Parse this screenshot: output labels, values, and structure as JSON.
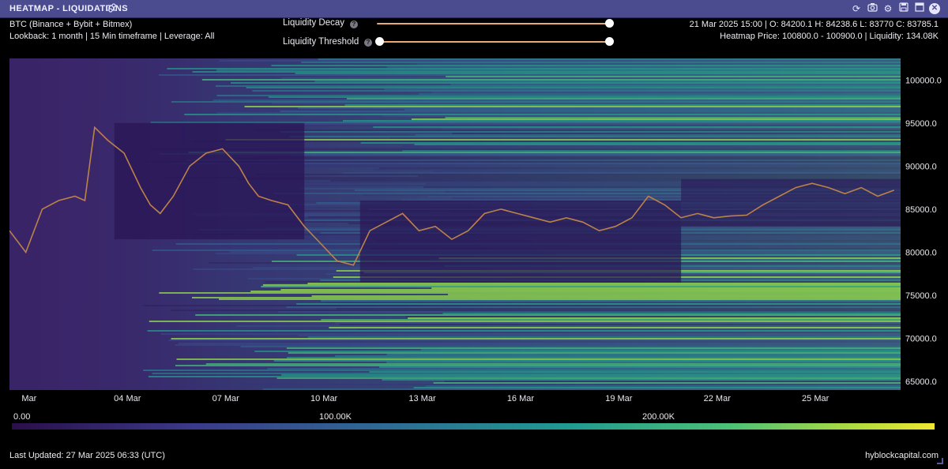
{
  "window": {
    "title": "HEATMAP - LIQUIDATIONS",
    "icons": [
      "sliders-icon",
      "refresh-icon",
      "camera-icon",
      "settings-icon",
      "save-icon",
      "expand-icon",
      "close-icon"
    ]
  },
  "info": {
    "instrument": "BTC (Binance + Bybit + Bitmex)",
    "params": "Lookback: 1 month | 15 Min timeframe | Leverage: All",
    "ohlc": "21 Mar 2025 15:00 | O: 84200.1 H: 84238.6 L: 83770 C: 83785.1",
    "heatmap_info": "Heatmap Price: 100800.0 - 100900.0 | Liquidity: 134.08K"
  },
  "controls": {
    "decay_label": "Liquidity Decay",
    "threshold_label": "Liquidity Threshold",
    "decay_value": 1.0,
    "threshold_range": [
      0.0,
      1.0
    ]
  },
  "colorbar": {
    "labels": [
      "0.00",
      "100.00K",
      "200.00K"
    ]
  },
  "footer": {
    "updated": "Last Updated: 27 Mar 2025 06:33 (UTC)",
    "brand": "hyblockcapital.com"
  },
  "chart_data": {
    "type": "heatmap",
    "x_ticks": [
      "Mar",
      "04 Mar",
      "07 Mar",
      "10 Mar",
      "13 Mar",
      "16 Mar",
      "19 Mar",
      "22 Mar",
      "25 Mar"
    ],
    "y_ticks": [
      "100000.0",
      "95000.0",
      "90000.0",
      "85000.0",
      "80000.0",
      "75000.0",
      "70000.0",
      "65000.0"
    ],
    "ylim": [
      64000,
      102500
    ],
    "price_series": {
      "day": [
        0.0,
        0.5,
        1.0,
        1.5,
        2.0,
        2.3,
        2.6,
        3.0,
        3.5,
        4.0,
        4.3,
        4.6,
        5.0,
        5.5,
        6.0,
        6.5,
        7.0,
        7.3,
        7.6,
        8.0,
        8.5,
        9.0,
        9.5,
        10.0,
        10.5,
        11.0,
        11.5,
        12.0,
        12.5,
        13.0,
        13.5,
        14.0,
        14.5,
        15.0,
        15.5,
        16.0,
        16.5,
        17.0,
        17.5,
        18.0,
        18.5,
        19.0,
        19.5,
        20.0,
        20.5,
        21.0,
        21.5,
        22.0,
        22.5,
        23.0,
        23.5,
        24.0,
        24.5,
        25.0,
        25.5,
        26.0,
        26.5,
        27.0
      ],
      "price": [
        82500,
        80000,
        85000,
        86000,
        86500,
        86000,
        94500,
        93000,
        91500,
        87500,
        85500,
        84500,
        86500,
        90000,
        91500,
        92000,
        90000,
        88000,
        86500,
        86000,
        85500,
        83000,
        81000,
        79000,
        78500,
        82500,
        83500,
        84500,
        82500,
        83000,
        81500,
        82500,
        84500,
        85000,
        84500,
        84000,
        83500,
        84000,
        83500,
        82500,
        83000,
        84000,
        86500,
        85500,
        84000,
        84500,
        84000,
        84200,
        84300,
        85500,
        86500,
        87500,
        88000,
        87500,
        86800,
        87500,
        86500,
        87200
      ]
    }
  }
}
